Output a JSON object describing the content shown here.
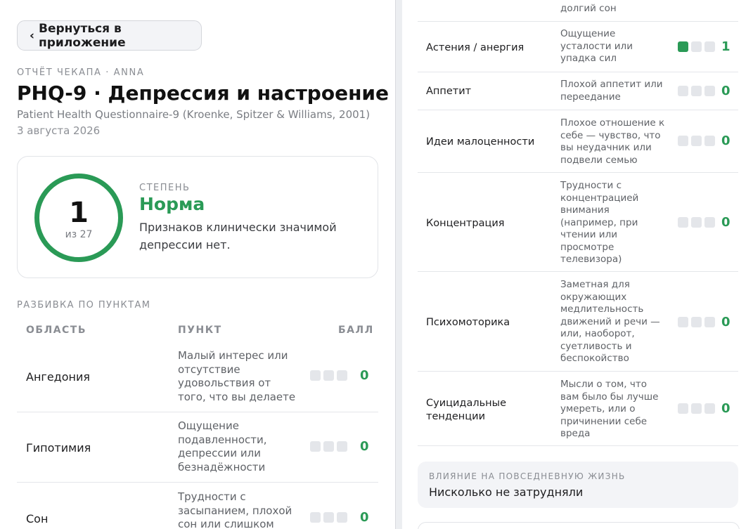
{
  "back_button": {
    "label": "Вернуться в приложение"
  },
  "header": {
    "eyebrow": "ОТЧЁТ ЧЕКАПА · ANNA",
    "title": "PHQ-9 · Депрессия и настроение",
    "subtitle": "Patient Health Questionnaire-9 (Kroenke, Spitzer & Williams, 2001)",
    "date": "3 августа 2026"
  },
  "summary": {
    "score": "1",
    "max_label": "из 27",
    "severity_label": "СТЕПЕНЬ",
    "severity": "Норма",
    "description": "Признаков клинически значимой депрессии нет.",
    "accent_color": "#2a9a56"
  },
  "breakdown": {
    "section_label": "РАЗБИВКА ПО ПУНКТАМ",
    "columns": {
      "area": "ОБЛАСТЬ",
      "item": "ПУНКТ",
      "score": "БАЛЛ"
    },
    "rows": [
      {
        "area": "Ангедония",
        "item": "Малый интерес или отсутствие удовольствия от того, что вы делаете",
        "score": "0",
        "filled": 0
      },
      {
        "area": "Гипотимия",
        "item": "Ощущение подавленности, депрессии или безнадёжности",
        "score": "0",
        "filled": 0
      },
      {
        "area": "Сон",
        "item": "Трудности с засыпанием, плохой сон или слишком долгий сон",
        "score": "0",
        "filled": 0
      },
      {
        "area": "Астения / анергия",
        "item": "Ощущение усталости или упадка сил",
        "score": "1",
        "filled": 1
      },
      {
        "area": "Аппетит",
        "item": "Плохой аппетит или переедание",
        "score": "0",
        "filled": 0
      },
      {
        "area": "Идеи малоценности",
        "item": "Плохое отношение к себе — чувство, что вы неудачник или подвели семью",
        "score": "0",
        "filled": 0
      },
      {
        "area": "Концентрация",
        "item": "Трудности с концентрацией внимания (например, при чтении или просмотре телевизора)",
        "score": "0",
        "filled": 0
      },
      {
        "area": "Психомоторика",
        "item": "Заметная для окружающих медлительность движений и речи — или, наоборот, суетливость и беспокойство",
        "score": "0",
        "filled": 0
      },
      {
        "area": "Суицидальные тенденции",
        "item": "Мысли о том, что вам было бы лучше умереть, или о причинении себе вреда",
        "score": "0",
        "filled": 0
      }
    ]
  },
  "impact": {
    "label": "ВЛИЯНИЕ НА ПОВСЕДНЕВНУЮ ЖИЗНЬ",
    "value": "Нисколько не затрудняли"
  }
}
